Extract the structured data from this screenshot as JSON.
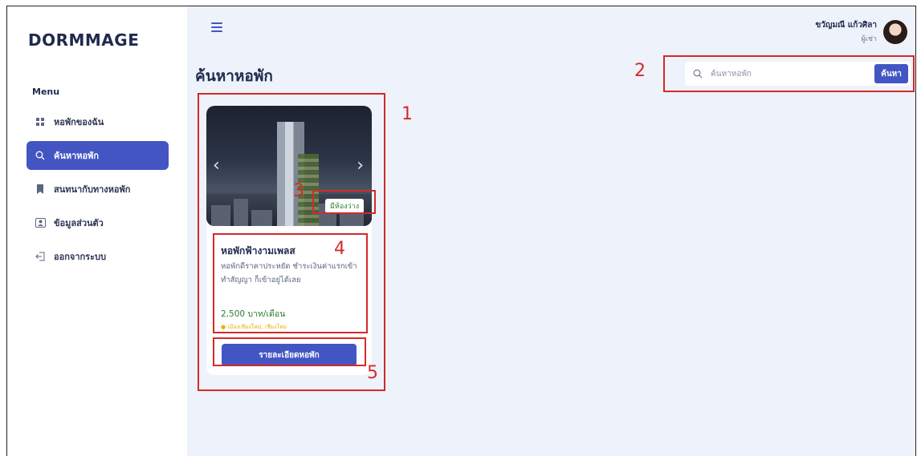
{
  "app": {
    "brand": "DORMMAGE"
  },
  "sidebar": {
    "menu_title": "Menu",
    "items": [
      {
        "label": "หอพักของฉัน",
        "icon": "grid-icon",
        "active": false
      },
      {
        "label": "ค้นหาหอพัก",
        "icon": "search-icon",
        "active": true
      },
      {
        "label": "สนทนากับทางหอพัก",
        "icon": "bookmark-icon",
        "active": false
      },
      {
        "label": "ข้อมูลส่วนตัว",
        "icon": "user-icon",
        "active": false
      },
      {
        "label": "ออกจากระบบ",
        "icon": "logout-icon",
        "active": false
      }
    ]
  },
  "header": {
    "user_name": "ขวัญมณี แก้วศิลา",
    "user_role": "ผู้เช่า"
  },
  "main": {
    "title": "ค้นหาหอพัก",
    "search": {
      "placeholder": "ค้นหาหอพัก",
      "button_label": "ค้นหา"
    }
  },
  "listing": {
    "status_badge": "มีห้องว่าง",
    "name": "หอพักฟ้างามเพลส",
    "description": "หอพักดีราคาประหยัด ชำระเงินค่าแรกเข้า ทำสัญญา ก็เข้าอยู่ได้เลย",
    "price": "2,500 บาท/เดือน",
    "location": "เมืองเชียงใหม่, เชียงใหม่",
    "detail_button_label": "รายละเอียดหอพัก"
  },
  "annotations": {
    "n1": "1",
    "n2": "2",
    "n3": "3",
    "n4": "4",
    "n5": "5"
  },
  "colors": {
    "primary": "#4355c3",
    "background": "#eef2fa",
    "annotation": "#d42a2a",
    "price": "#2e7d32",
    "location": "#e6b400"
  }
}
